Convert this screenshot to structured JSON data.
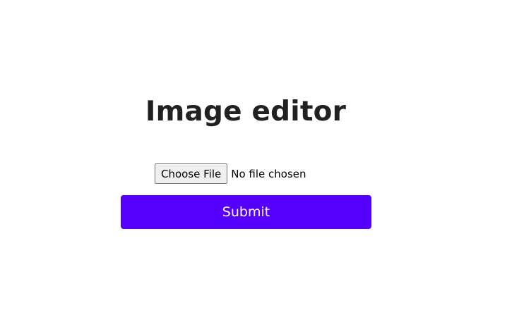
{
  "page": {
    "title": "Image editor"
  },
  "upload": {
    "choose_file_label": "Choose File",
    "status_text": "No file chosen"
  },
  "form": {
    "submit_label": "Submit"
  },
  "colors": {
    "accent": "#5500ff",
    "button_gray": "#efefef",
    "text": "#212121",
    "background": "#ffffff"
  }
}
